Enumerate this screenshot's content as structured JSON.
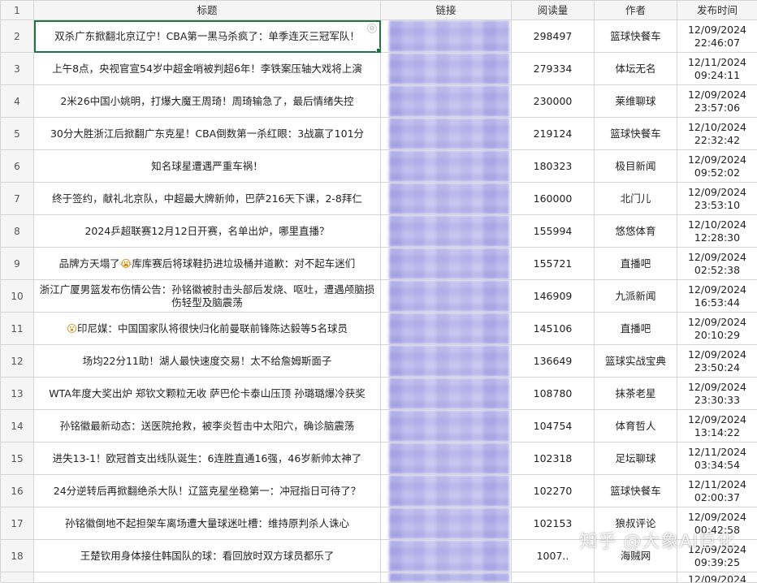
{
  "spreadsheet": {
    "column_headers": [
      "标题",
      "链接",
      "阅读量",
      "作者",
      "发布时间"
    ],
    "header_row_number": "1",
    "last_row_number": "19",
    "last_row_partial_time": "12/09/2024",
    "rows": [
      {
        "row": "2",
        "title": "双杀广东掀翻北京辽宁！CBA第一黑马杀疯了：单季连灭三冠军队！",
        "reads": "298497",
        "author": "篮球快餐车",
        "date": "12/09/2024",
        "time": "22:46:07"
      },
      {
        "row": "3",
        "title": "上午8点，央视官宣54岁中超金哨被判超6年！李铁案压轴大戏将上演",
        "reads": "279334",
        "author": "体坛无名",
        "date": "12/11/2024",
        "time": "09:24:11"
      },
      {
        "row": "4",
        "title": "2米26中国小姚明，打爆大魔王周琦！周琦输急了，最后情绪失控",
        "reads": "230000",
        "author": "莱维聊球",
        "date": "12/09/2024",
        "time": "23:57:06"
      },
      {
        "row": "5",
        "title": "30分大胜浙江后掀翻广东克星！CBA倒数第一杀红眼：3战赢了101分",
        "reads": "219124",
        "author": "篮球快餐车",
        "date": "12/10/2024",
        "time": "22:32:42"
      },
      {
        "row": "6",
        "title": "知名球星遭遇严重车祸！",
        "reads": "180323",
        "author": "极目新闻",
        "date": "12/09/2024",
        "time": "09:52:02"
      },
      {
        "row": "7",
        "title": "终于签约，献礼北京队，中超最大牌新帅，巴萨216天下课，2-8拜仁",
        "reads": "160000",
        "author": "北门儿",
        "date": "12/09/2024",
        "time": "23:53:10"
      },
      {
        "row": "8",
        "title": "2024乒超联赛12月12日开赛，名单出炉，哪里直播？",
        "reads": "155994",
        "author": "悠悠体育",
        "date": "12/10/2024",
        "time": "12:28:30"
      },
      {
        "row": "9",
        "title_prefix": "品牌方天塌了",
        "title_emoji": "😭",
        "title_suffix": "库库赛后将球鞋扔进垃圾桶并道歉：对不起车迷们",
        "reads": "155721",
        "author": "直播吧",
        "date": "12/09/2024",
        "time": "02:52:38"
      },
      {
        "row": "10",
        "title": "浙江广厦男篮发布伤情公告：孙铭徽被肘击头部后发烧、呕吐，遭遇颅脑损伤轻型及脑震荡",
        "reads": "146909",
        "author": "九派新闻",
        "date": "12/09/2024",
        "time": "16:53:44"
      },
      {
        "row": "11",
        "title_emoji": "😮",
        "title_suffix": "印尼媒：中国国家队将很快归化前曼联前锋陈达毅等5名球员",
        "reads": "145106",
        "author": "直播吧",
        "date": "12/09/2024",
        "time": "20:10:29"
      },
      {
        "row": "12",
        "title": "场均22分11助！湖人最快速度交易！太不给詹姆斯面子",
        "reads": "136649",
        "author": "篮球实战宝典",
        "date": "12/09/2024",
        "time": "23:50:24"
      },
      {
        "row": "13",
        "title": "WTA年度大奖出炉 郑钦文颗粒无收 萨巴伦卡泰山压顶 孙璐璐爆冷获奖",
        "reads": "108780",
        "author": "抹茶老星",
        "date": "12/09/2024",
        "time": "23:30:33"
      },
      {
        "row": "14",
        "title": "孙铭徽最新动态：送医院抢救，被李炎哲击中太阳穴，确诊脑震荡",
        "reads": "104754",
        "author": "体育哲人",
        "date": "12/09/2024",
        "time": "13:14:22"
      },
      {
        "row": "15",
        "title": "进失13-1！欧冠首支出线队诞生：6连胜直通16强，46岁新帅太神了",
        "reads": "102318",
        "author": "足坛聊球",
        "date": "12/11/2024",
        "time": "03:34:54"
      },
      {
        "row": "16",
        "title": "24分逆转后再掀翻绝杀大队！辽篮克星坐稳第一：冲冠指日可待了？",
        "reads": "102270",
        "author": "篮球快餐车",
        "date": "12/11/2024",
        "time": "02:00:37"
      },
      {
        "row": "17",
        "title": "孙铭徽倒地不起担架车离场遭大量球迷吐槽：维持原判杀人诛心",
        "reads": "102153",
        "author": "狼叔评论",
        "date": "12/09/2024",
        "time": "00:42:58"
      },
      {
        "row": "18",
        "title": "王楚钦用身体接住韩国队的球：看回放时双方球员都乐了",
        "reads": "1007..",
        "author": "海贼网",
        "date": "12/09/2024",
        "time": "09:39:25"
      }
    ]
  },
  "watermark": "知乎 @大象AI巨化"
}
